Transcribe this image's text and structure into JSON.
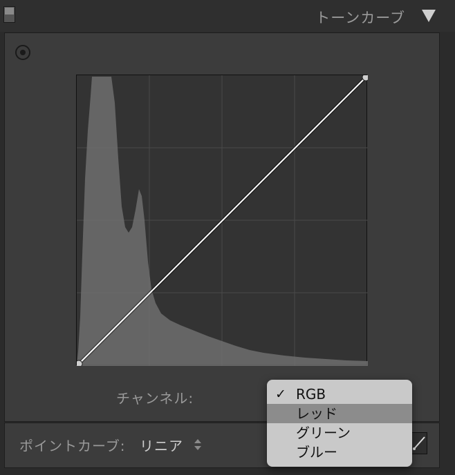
{
  "header": {
    "title": "トーンカーブ"
  },
  "channel": {
    "label": "チャンネル:",
    "options": [
      {
        "label": "RGB",
        "checked": true,
        "highlighted": false
      },
      {
        "label": "レッド",
        "checked": false,
        "highlighted": true
      },
      {
        "label": "グリーン",
        "checked": false,
        "highlighted": false
      },
      {
        "label": "ブルー",
        "checked": false,
        "highlighted": false
      }
    ],
    "check_mark": "✓"
  },
  "point_curve": {
    "label": "ポイントカーブ:",
    "value": "リニア"
  },
  "curve": {
    "points": [
      [
        0,
        0
      ],
      [
        1,
        1
      ]
    ]
  },
  "colors": {
    "background": "#2b2b2b",
    "panel": "#3c3c3c",
    "curve_line": "#ffffff",
    "histogram": "#8a8a8a",
    "menu": "#c9c9c9",
    "menu_highlight": "#8c8c8c"
  }
}
